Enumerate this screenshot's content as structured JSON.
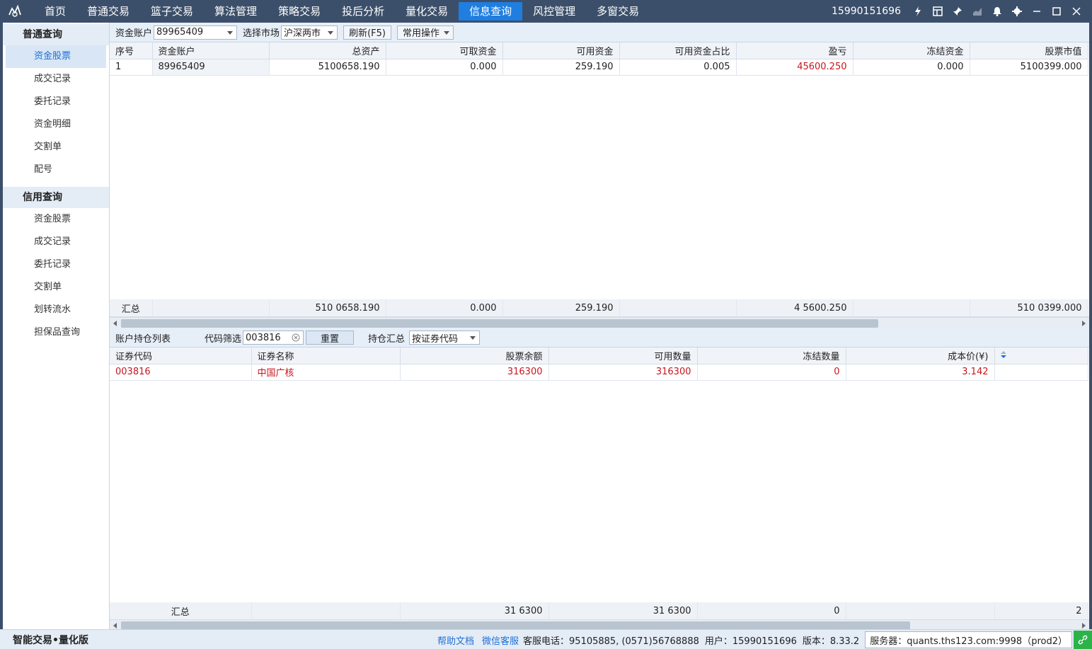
{
  "topbar": {
    "nav": [
      "首页",
      "普通交易",
      "篮子交易",
      "算法管理",
      "策略交易",
      "投后分析",
      "量化交易",
      "信息查询",
      "风控管理",
      "多窗交易"
    ],
    "active_index": 7,
    "phone": "15990151696",
    "icons": [
      "lightning-icon",
      "layout-icon",
      "pin-icon",
      "chart-icon",
      "bell-icon",
      "gear-icon",
      "minimize-icon",
      "maximize-icon",
      "close-icon"
    ]
  },
  "sidebar": {
    "groups": [
      {
        "title": "普通查询",
        "items": [
          "资金股票",
          "成交记录",
          "委托记录",
          "资金明细",
          "交割单",
          "配号"
        ]
      },
      {
        "title": "信用查询",
        "items": [
          "资金股票",
          "成交记录",
          "委托记录",
          "交割单",
          "划转流水",
          "担保品查询"
        ]
      }
    ],
    "active": "普通查询/资金股票"
  },
  "toolbar1": {
    "account_label": "资金账户",
    "account_value": "89965409",
    "market_label": "选择市场",
    "market_value": "沪深两市",
    "refresh_label": "刷新(F5)",
    "ops_label": "常用操作"
  },
  "funds_table": {
    "headers": [
      "序号",
      "资金账户",
      "总资产",
      "可取资金",
      "可用资金",
      "可用资金占比",
      "盈亏",
      "冻结资金",
      "股票市值"
    ],
    "rows": [
      [
        "1",
        "89965409",
        "5100658.190",
        "0.000",
        "259.190",
        "0.005",
        "45600.250",
        "0.000",
        "5100399.000"
      ]
    ],
    "summary": [
      "汇总",
      "",
      "510 0658.190",
      "0.000",
      "259.190",
      "",
      "4 5600.250",
      "",
      "510 0399.000"
    ]
  },
  "toolbar2": {
    "title": "账户持仓列表",
    "filter_label": "代码筛选",
    "filter_value": "003816",
    "reset_label": "重置",
    "summary_label": "持仓汇总",
    "summary_value": "按证券代码"
  },
  "positions_table": {
    "headers": [
      "证券代码",
      "证券名称",
      "股票余额",
      "可用数量",
      "冻结数量",
      "成本价(¥)"
    ],
    "rows": [
      [
        "003816",
        "中国广核",
        "316300",
        "316300",
        "0",
        "3.142"
      ]
    ],
    "summary": [
      "汇总",
      "",
      "31 6300",
      "31 6300",
      "0",
      "",
      "2"
    ]
  },
  "statusbar": {
    "brand": "智能交易•量化版",
    "help": "帮助文档",
    "wechat": "微信客服",
    "hotline": "客服电话：95105885, (0571)56768888",
    "user": "用户：15990151696",
    "version": "版本：8.33.2",
    "server": "服务器：quants.ths123.com:9998（prod2）"
  },
  "colors": {
    "topbar": "#3c4f6a",
    "active": "#1f7ee0",
    "loss_profit": "#c8161d",
    "link": "#1f6fd6",
    "connected": "#2bb34a"
  }
}
